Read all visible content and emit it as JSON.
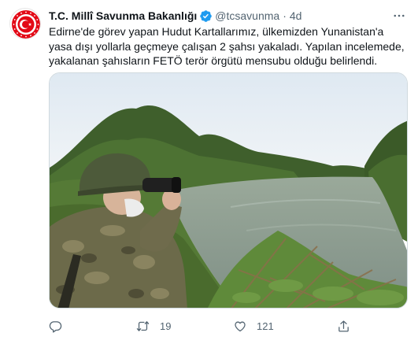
{
  "tweet": {
    "display_name": "T.C. Millî Savunma Bakanlığı",
    "handle": "@tcsavunma",
    "separator": "·",
    "time": "4d",
    "text": "Edirne'de görev yapan Hudut Kartallarımız, ülkemizden Yunanistan'a yasa dışı yollarla geçmeye çalışan 2 şahsı yakaladı. Yapılan incelemede, yakalanan şahısların FETÖ terör örgütü mensubu olduğu belirlendi."
  },
  "icons": {
    "verified": "verified-badge-icon",
    "more": "more-options-icon",
    "reply": "reply-icon",
    "retweet": "retweet-icon",
    "like": "heart-icon",
    "share": "share-icon"
  },
  "actions": {
    "reply_count": "",
    "retweet_count": "19",
    "like_count": "121"
  },
  "colors": {
    "accent": "#1d9bf0",
    "secondary_text": "#536471",
    "avatar_red": "#e30a17"
  }
}
